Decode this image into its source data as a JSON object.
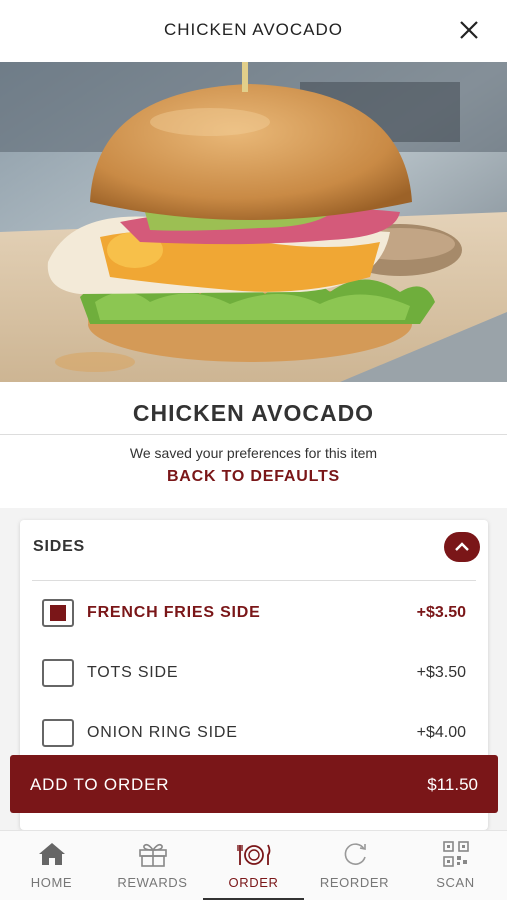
{
  "header": {
    "title": "CHICKEN AVOCADO"
  },
  "item": {
    "title": "CHICKEN AVOCADO",
    "preferences_note": "We saved your preferences for this item",
    "back_to_defaults": "BACK TO DEFAULTS"
  },
  "sides": {
    "label": "SIDES",
    "options": [
      {
        "label": "FRENCH FRIES SIDE",
        "price": "+$3.50",
        "selected": true
      },
      {
        "label": "TOTS SIDE",
        "price": "+$3.50",
        "selected": false
      },
      {
        "label": "ONION RING SIDE",
        "price": "+$4.00",
        "selected": false
      }
    ]
  },
  "add_to_order": {
    "label": "ADD TO ORDER",
    "total": "$11.50"
  },
  "tabbar": {
    "tabs": [
      {
        "label": "HOME",
        "icon": "home-icon",
        "active": false
      },
      {
        "label": "REWARDS",
        "icon": "gift-icon",
        "active": false
      },
      {
        "label": "ORDER",
        "icon": "plate-utensils-icon",
        "active": true
      },
      {
        "label": "REORDER",
        "icon": "refresh-icon",
        "active": false
      },
      {
        "label": "SCAN",
        "icon": "qr-code-icon",
        "active": false
      }
    ]
  },
  "colors": {
    "accent": "#7a1618",
    "text": "#333333",
    "inactive": "#777777"
  }
}
